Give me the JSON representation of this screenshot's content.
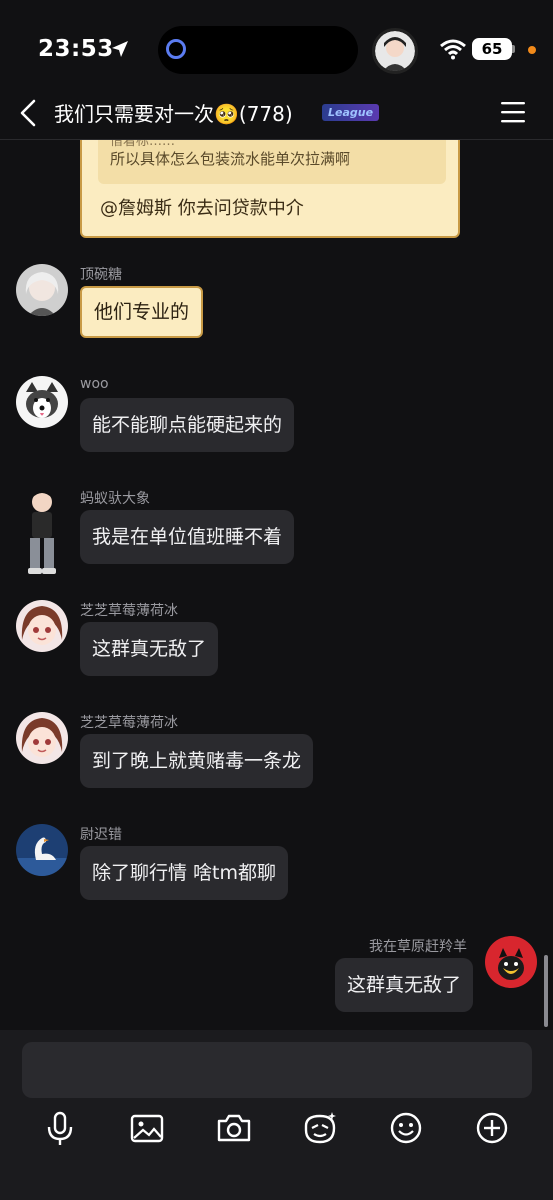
{
  "status": {
    "time": "23:53",
    "battery": "65"
  },
  "header": {
    "title": "我们只需要对一次🥺(778)",
    "level_badge": "League"
  },
  "top_card": {
    "quote_cut_text": "借着标……",
    "quote_text": "所以具体怎么包装流水能单次拉满啊",
    "main_text": "@詹姆斯 你去问贷款中介"
  },
  "messages": [
    {
      "sender": "顶碗糖",
      "text": "他们专业的",
      "style": "yellow"
    },
    {
      "sender": "woo",
      "text": "能不能聊点能硬起来的",
      "style": "dark"
    },
    {
      "sender": "蚂蚁驮大象",
      "text": "我是在单位值班睡不着",
      "style": "dark"
    },
    {
      "sender": "芝芝草莓薄荷冰",
      "text": "这群真无敌了",
      "style": "dark"
    },
    {
      "sender": "芝芝草莓薄荷冰",
      "text": "到了晚上就黄赌毒一条龙",
      "style": "dark"
    },
    {
      "sender": "尉迟错",
      "text": "除了聊行情 啥tm都聊",
      "style": "dark"
    },
    {
      "sender": "我在草原赶羚羊",
      "text": "这群真无敌了",
      "style": "self"
    }
  ],
  "input": {
    "placeholder": ""
  },
  "toolbar": [
    "microphone-icon",
    "image-icon",
    "camera-icon",
    "sticker-icon",
    "emoji-icon",
    "plus-icon"
  ],
  "colors": {
    "background": "#111113",
    "bubble": "#2a2a2e",
    "yellow_bubble": "#fbecc1"
  }
}
